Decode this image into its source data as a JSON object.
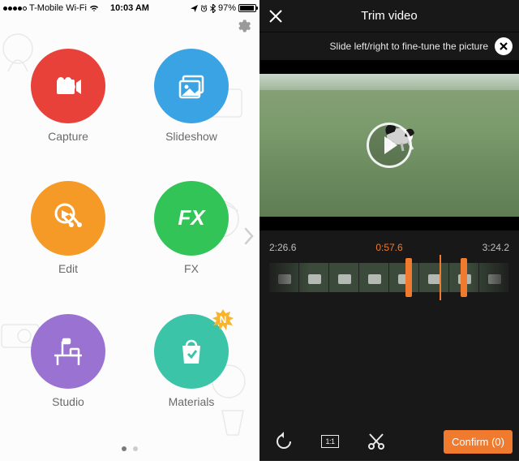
{
  "statusbar": {
    "carrier": "T-Mobile Wi-Fi",
    "time": "10:03 AM",
    "battery_pct": "97%"
  },
  "left": {
    "items": {
      "capture": "Capture",
      "slideshow": "Slideshow",
      "edit": "Edit",
      "fx": "FX",
      "studio": "Studio",
      "materials": "Materials"
    },
    "badge_new": "N"
  },
  "right": {
    "title": "Trim video",
    "hint": "Slide left/right to fine-tune the picture",
    "time_start": "2:26.6",
    "time_current": "0:57.6",
    "time_end": "3:24.2",
    "aspect_label": "1:1",
    "confirm_label": "Confirm (0)"
  }
}
